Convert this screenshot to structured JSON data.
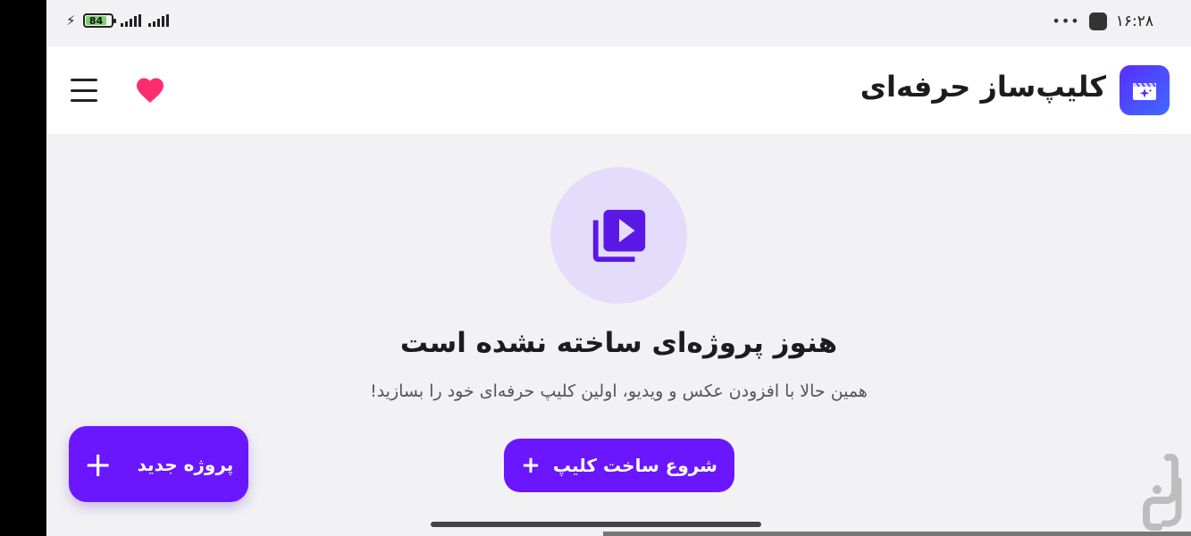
{
  "status_bar": {
    "battery_level": "84",
    "time": "۱۶:۲۸",
    "more_dots": "•••",
    "icons": [
      "charging-bolt-icon",
      "battery-icon",
      "signal-icon",
      "signal-icon",
      "app-notification-icon"
    ]
  },
  "app_bar": {
    "title": "کلیپ‌ساز حرفه‌ای",
    "logo_icon": "movie-sparkle-icon",
    "favorite_icon": "heart-icon",
    "menu_icon": "hamburger-menu-icon"
  },
  "empty_state": {
    "icon": "video-library-icon",
    "title": "هنوز پروژه‌ای ساخته نشده است",
    "subtitle": "همین حالا با افزودن عکس و ویدیو، اولین کلیپ حرفه‌ای خود را بسازید!"
  },
  "start_button": {
    "label": "شروع ساخت کلیپ",
    "icon": "+"
  },
  "fab": {
    "label": "پروژه جدید",
    "icon": "+"
  },
  "colors": {
    "accent": "#6a16ff",
    "heart": "#ff2d6f",
    "circle_bg": "#e4dcfb",
    "logo_gradient_start": "#5a2dff",
    "logo_gradient_end": "#3e6bff"
  }
}
